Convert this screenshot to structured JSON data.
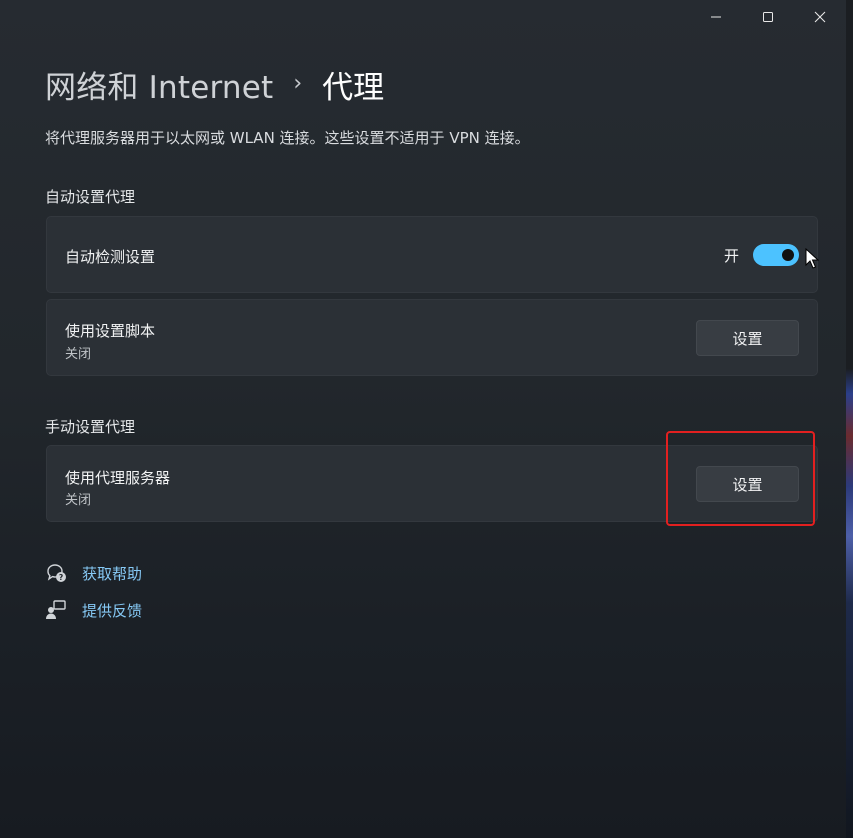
{
  "window": {
    "controls": {
      "minimize": "minimize-icon",
      "maximize": "maximize-icon",
      "close": "close-icon"
    }
  },
  "breadcrumb": {
    "root": "网络和 Internet",
    "separator": "›",
    "current": "代理"
  },
  "description": "将代理服务器用于以太网或 WLAN 连接。这些设置不适用于 VPN 连接。",
  "auto_section": {
    "title": "自动设置代理",
    "detect": {
      "title": "自动检测设置",
      "toggle_label": "开",
      "toggle_on": true
    },
    "script": {
      "title": "使用设置脚本",
      "subtitle": "关闭",
      "button": "设置"
    }
  },
  "manual_section": {
    "title": "手动设置代理",
    "proxy": {
      "title": "使用代理服务器",
      "subtitle": "关闭",
      "button": "设置"
    }
  },
  "links": {
    "help": {
      "label": "获取帮助",
      "icon": "help-icon"
    },
    "feedback": {
      "label": "提供反馈",
      "icon": "feedback-icon"
    }
  },
  "colors": {
    "accent": "#4cc2ff",
    "link": "#86c9f5",
    "highlight": "#e22020"
  }
}
